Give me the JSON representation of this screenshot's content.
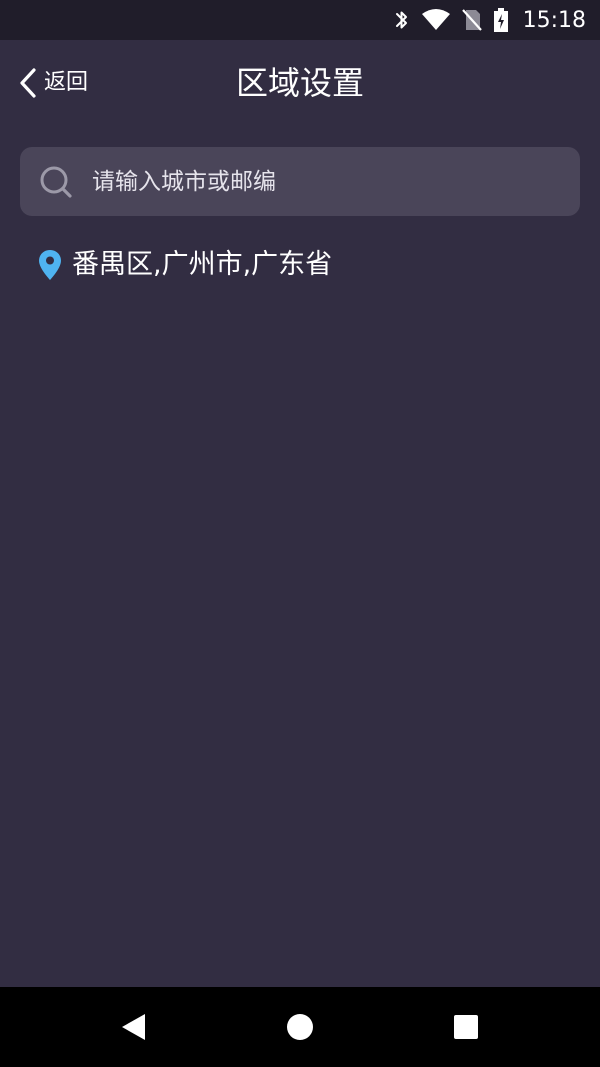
{
  "status_bar": {
    "time": "15:18",
    "icons": [
      "bluetooth-icon",
      "wifi-icon",
      "no-sim-icon",
      "battery-charging-icon"
    ]
  },
  "header": {
    "back_label": "返回",
    "title": "区域设置"
  },
  "search": {
    "placeholder": "请输入城市或邮编",
    "value": ""
  },
  "current_location": {
    "icon": "map-pin-icon",
    "text": "番禺区,广州市,广东省"
  },
  "nav_bar": {
    "buttons": [
      "back-triangle-icon",
      "home-circle-icon",
      "recents-square-icon"
    ]
  },
  "colors": {
    "background": "#322d42",
    "status_bar": "#201d2a",
    "search_bg": "#4a4559",
    "pin": "#4fb3f0",
    "text": "#ffffff"
  }
}
